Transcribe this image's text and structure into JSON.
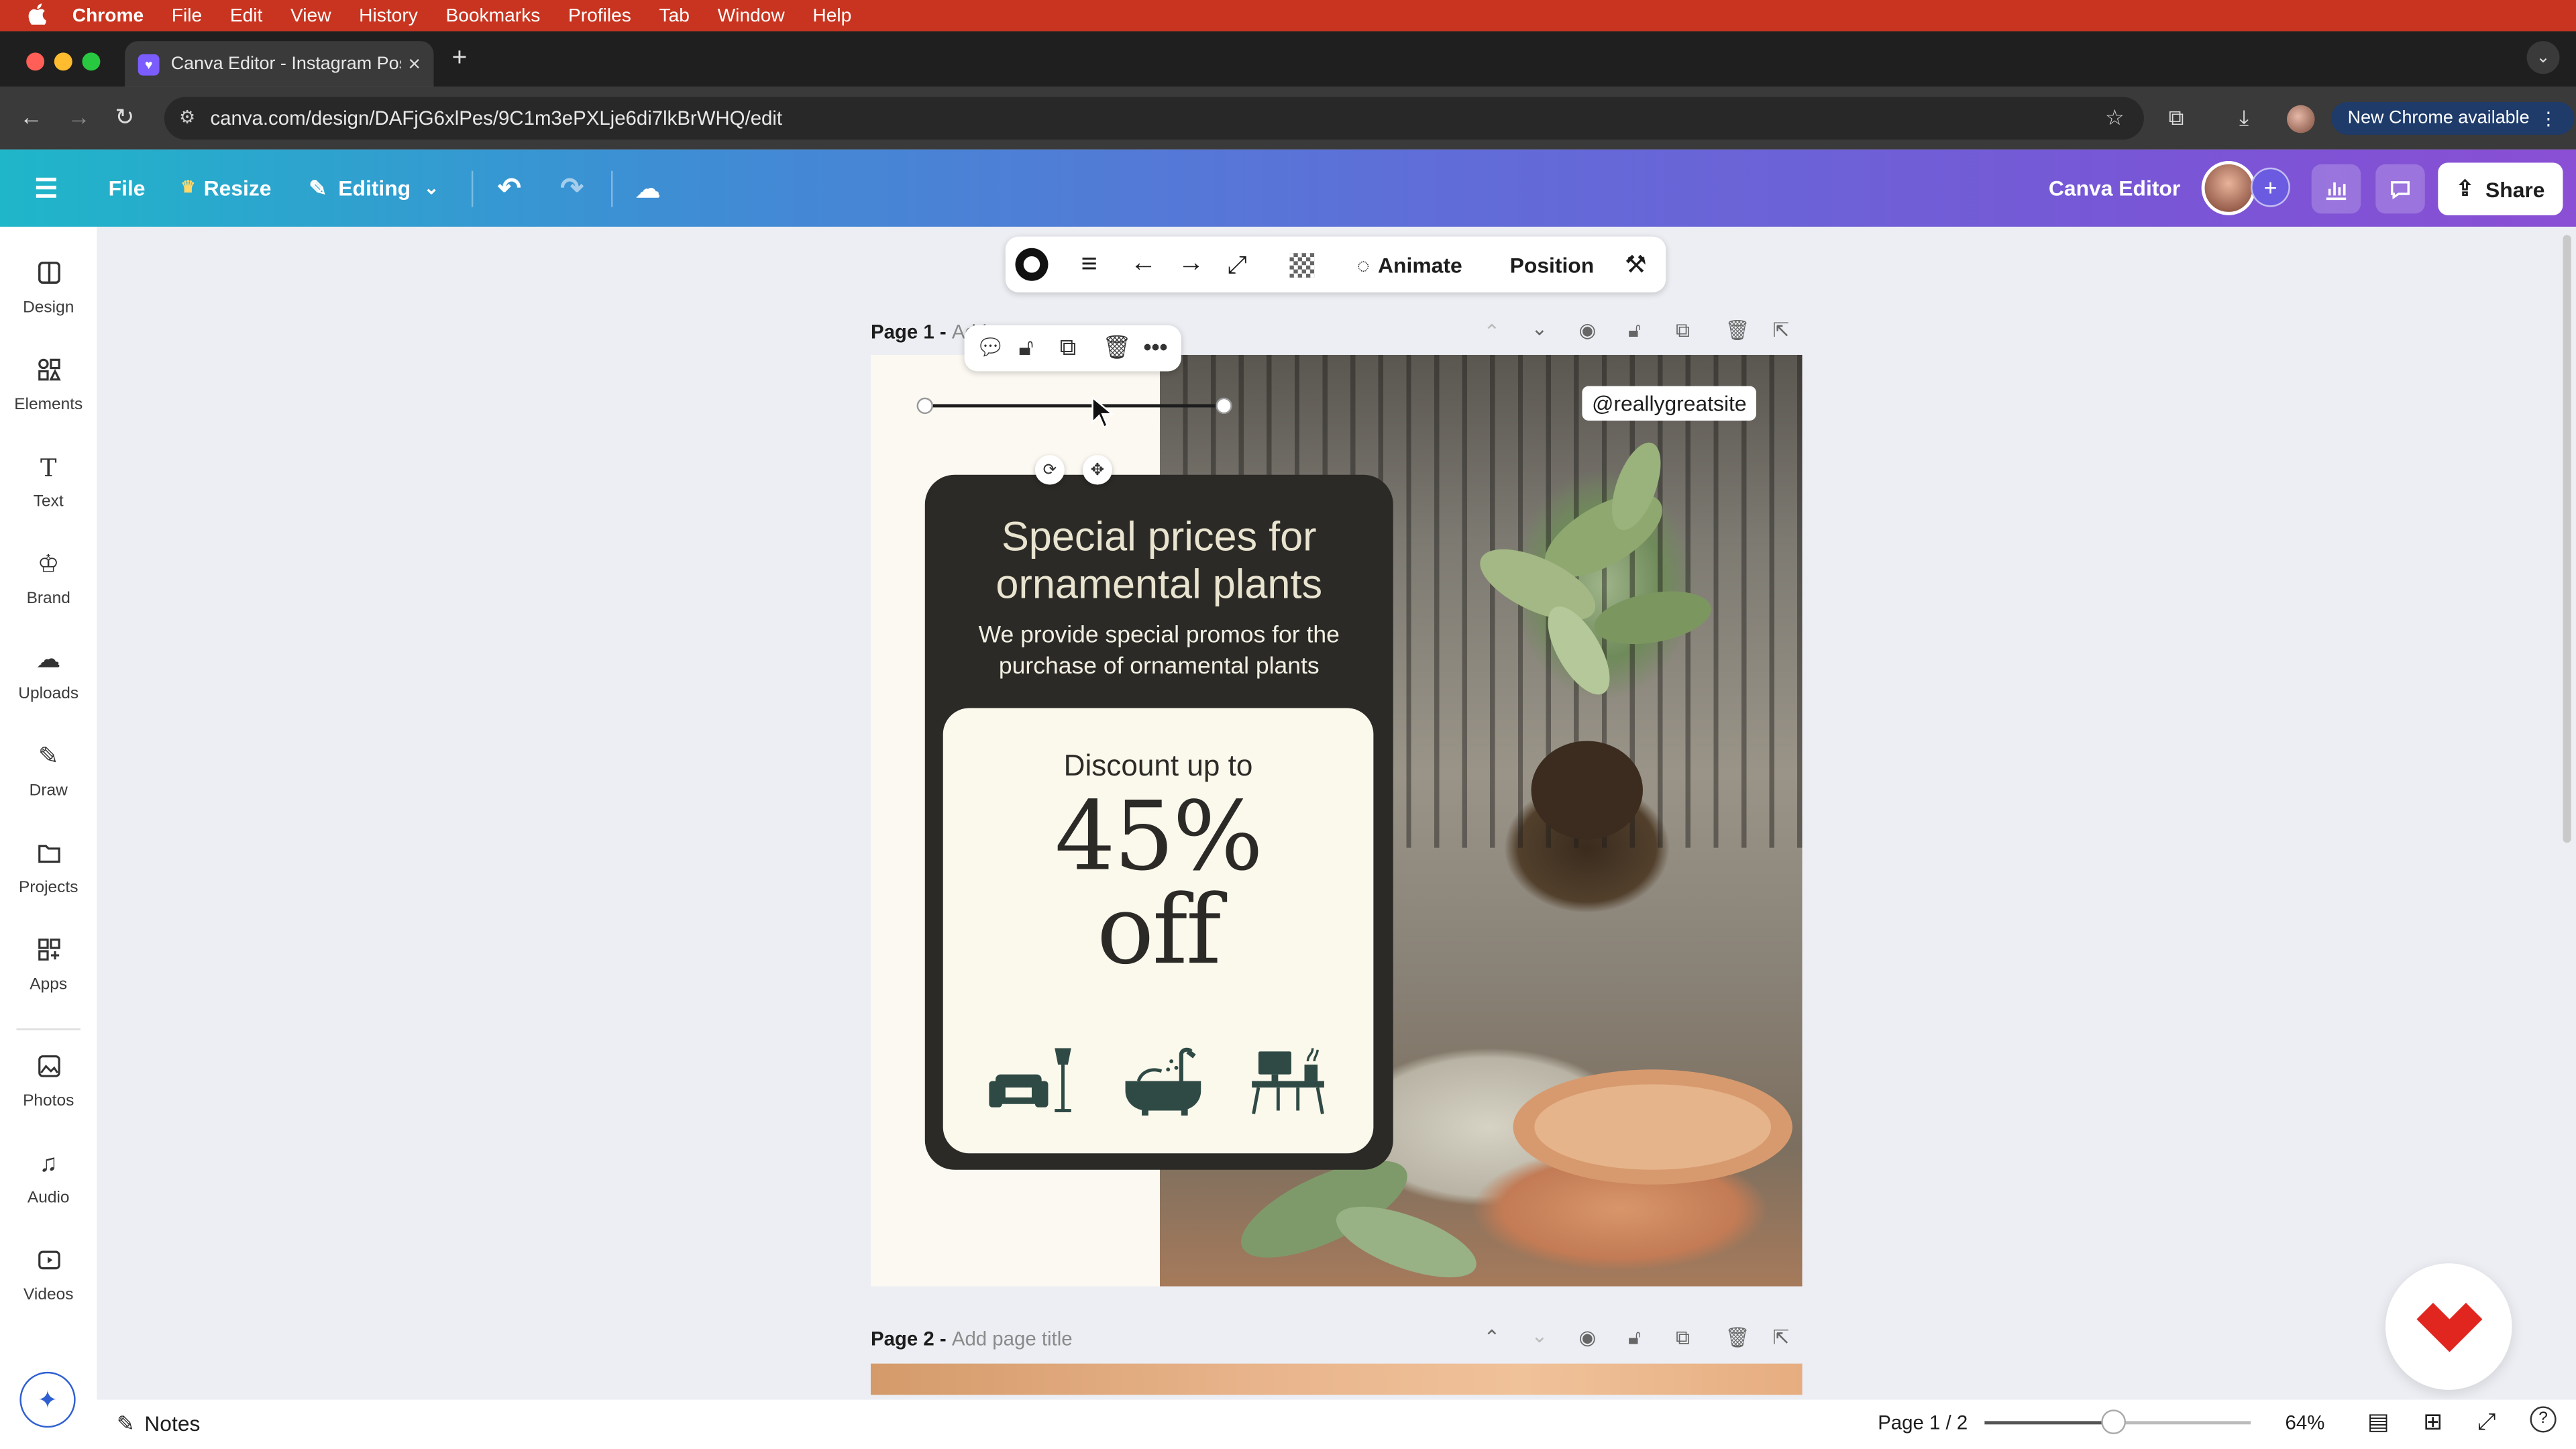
{
  "menubar": {
    "apple": "",
    "items": [
      "Chrome",
      "File",
      "Edit",
      "View",
      "History",
      "Bookmarks",
      "Profiles",
      "Tab",
      "Window",
      "Help"
    ]
  },
  "browser": {
    "tab_title": "Canva Editor - Instagram Pos",
    "url": "canva.com/design/DAFjG6xlPes/9C1m3ePXLje6di7lkBrWHQ/edit",
    "new_chrome": "New Chrome available"
  },
  "canva_bar": {
    "file": "File",
    "resize": "Resize",
    "editing": "Editing",
    "project_name": "Canva Editor",
    "share": "Share"
  },
  "sidebar": {
    "items": [
      {
        "label": "Design",
        "icon": "design-icon"
      },
      {
        "label": "Elements",
        "icon": "elements-icon"
      },
      {
        "label": "Text",
        "icon": "text-icon"
      },
      {
        "label": "Brand",
        "icon": "brand-icon"
      },
      {
        "label": "Uploads",
        "icon": "uploads-icon"
      },
      {
        "label": "Draw",
        "icon": "draw-icon"
      },
      {
        "label": "Projects",
        "icon": "projects-icon"
      },
      {
        "label": "Apps",
        "icon": "apps-icon"
      },
      {
        "label": "Photos",
        "icon": "photos-icon"
      },
      {
        "label": "Audio",
        "icon": "audio-icon"
      },
      {
        "label": "Videos",
        "icon": "videos-icon"
      }
    ]
  },
  "element_toolbar": {
    "animate": "Animate",
    "position": "Position"
  },
  "pages": {
    "page1_label": "Page 1 - ",
    "page1_title_placeholder": "Add",
    "page2_label": "Page 2 - ",
    "page2_title_placeholder": "Add page title"
  },
  "design": {
    "handle": "@reallygreatsite",
    "title": "Special prices for ornamental plants",
    "subtitle": "We provide special promos for the purchase of ornamental plants",
    "discount_intro": "Discount up to",
    "discount_value": "45%",
    "discount_suffix": "off",
    "colors": {
      "card_dark": "#2b2a26",
      "card_light": "#fbf8ec",
      "icon_green": "#2f4a45"
    }
  },
  "bottom_bar": {
    "notes": "Notes",
    "page_indicator": "Page 1 / 2",
    "zoom": "64%",
    "zoom_level": 0.49
  }
}
